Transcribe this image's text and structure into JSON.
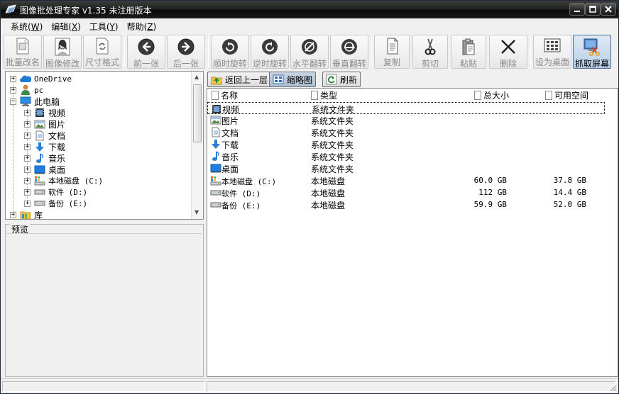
{
  "window": {
    "title": "图像批处理专家 v1.35 未注册版本"
  },
  "menu": [
    {
      "label": "系统(",
      "key": "W",
      "close": ")"
    },
    {
      "label": "编辑(",
      "key": "X",
      "close": ")"
    },
    {
      "label": "工具(",
      "key": "Y",
      "close": ")"
    },
    {
      "label": "帮助(",
      "key": "Z",
      "close": ")"
    }
  ],
  "toolbar": {
    "batch_rename": "批量改名",
    "image_edit": "图像修改",
    "size_format": "尺寸格式",
    "prev": "前一张",
    "next": "后一张",
    "rotate_cw": "顺时旋转",
    "rotate_ccw": "逆时旋转",
    "flip_h": "水平翻转",
    "flip_v": "垂直翻转",
    "copy": "复制",
    "cut": "剪切",
    "paste": "粘贴",
    "delete": "删除",
    "set_desktop": "设为桌面",
    "capture": "抓取屏幕"
  },
  "tree": {
    "items": [
      {
        "label": "OneDrive",
        "icon": "cloud-icon"
      },
      {
        "label": "pc",
        "icon": "user-icon"
      },
      {
        "label": "此电脑",
        "icon": "computer-icon"
      },
      {
        "label": "视频",
        "icon": "video-folder-icon"
      },
      {
        "label": "图片",
        "icon": "picture-folder-icon"
      },
      {
        "label": "文档",
        "icon": "document-folder-icon"
      },
      {
        "label": "下载",
        "icon": "download-icon"
      },
      {
        "label": "音乐",
        "icon": "music-icon"
      },
      {
        "label": "桌面",
        "icon": "desktop-icon"
      },
      {
        "label": "本地磁盘 (C:)",
        "icon": "system-drive-icon"
      },
      {
        "label": "软件 (D:)",
        "icon": "drive-icon"
      },
      {
        "label": "备份 (E:)",
        "icon": "drive-icon"
      },
      {
        "label": "库",
        "icon": "library-folder-icon"
      }
    ]
  },
  "preview": {
    "title": "预览"
  },
  "file_toolbar": {
    "up": "返回上一层",
    "thumbs": "缩略图",
    "refresh": "刷新"
  },
  "list": {
    "columns": {
      "name": "名称",
      "type": "类型",
      "total": "总大小",
      "free": "可用空间"
    },
    "rows": [
      {
        "name": "视频",
        "type": "系统文件夹",
        "total": "",
        "free": "",
        "icon": "video-folder-icon"
      },
      {
        "name": "图片",
        "type": "系统文件夹",
        "total": "",
        "free": "",
        "icon": "picture-folder-icon"
      },
      {
        "name": "文档",
        "type": "系统文件夹",
        "total": "",
        "free": "",
        "icon": "document-folder-icon"
      },
      {
        "name": "下载",
        "type": "系统文件夹",
        "total": "",
        "free": "",
        "icon": "download-icon"
      },
      {
        "name": "音乐",
        "type": "系统文件夹",
        "total": "",
        "free": "",
        "icon": "music-icon"
      },
      {
        "name": "桌面",
        "type": "系统文件夹",
        "total": "",
        "free": "",
        "icon": "desktop-icon"
      },
      {
        "name": "本地磁盘 (C:)",
        "type": "本地磁盘",
        "total": "60.0 GB",
        "free": "37.8 GB",
        "icon": "system-drive-icon"
      },
      {
        "name": "软件 (D:)",
        "type": "本地磁盘",
        "total": "112 GB",
        "free": "14.4 GB",
        "icon": "drive-icon"
      },
      {
        "name": "备份 (E:)",
        "type": "本地磁盘",
        "total": "59.9 GB",
        "free": "52.0 GB",
        "icon": "drive-icon"
      }
    ]
  }
}
